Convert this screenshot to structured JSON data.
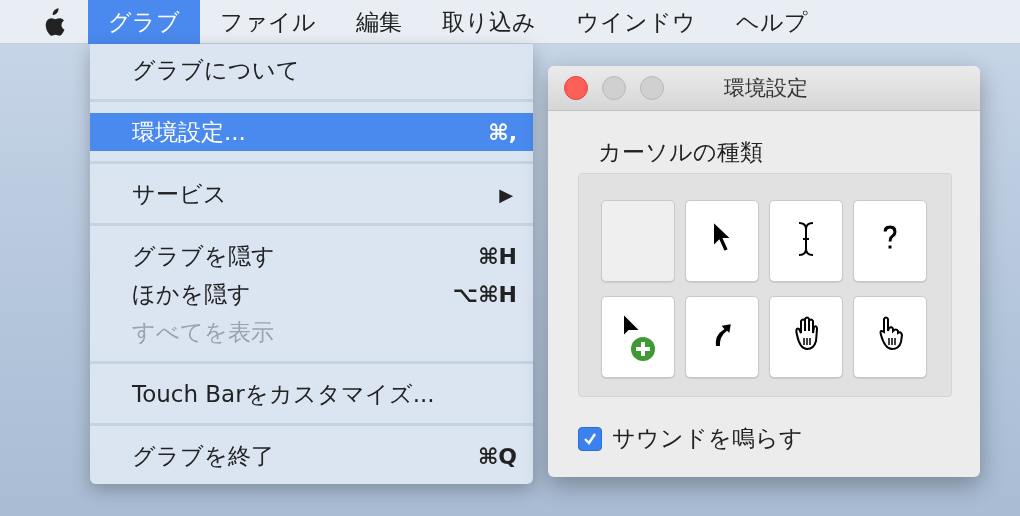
{
  "menu_bar": {
    "items": [
      {
        "label": "グラブ",
        "selected": true
      },
      {
        "label": "ファイル",
        "selected": false
      },
      {
        "label": "編集",
        "selected": false
      },
      {
        "label": "取り込み",
        "selected": false
      },
      {
        "label": "ウインドウ",
        "selected": false
      },
      {
        "label": "ヘルプ",
        "selected": false
      }
    ]
  },
  "dropdown_menu": {
    "sections": [
      {
        "items": [
          {
            "label": "グラブについて",
            "selected": false,
            "disabled": false
          }
        ]
      },
      {
        "items": [
          {
            "label": "環境設定...",
            "shortcut": "⌘,",
            "selected": true,
            "disabled": false
          }
        ]
      },
      {
        "items": [
          {
            "label": "サービス",
            "submenu": "▶",
            "selected": false,
            "disabled": false
          }
        ]
      },
      {
        "items": [
          {
            "label": "グラブを隠す",
            "shortcut": "⌘H",
            "selected": false,
            "disabled": false
          },
          {
            "label": "ほかを隠す",
            "shortcut": "⌥⌘H",
            "selected": false,
            "disabled": false
          },
          {
            "label": "すべてを表示",
            "selected": false,
            "disabled": true
          }
        ]
      },
      {
        "items": [
          {
            "label": "Touch Barをカスタマイズ...",
            "selected": false,
            "disabled": false
          }
        ]
      },
      {
        "items": [
          {
            "label": "グラブを終了",
            "shortcut": "⌘Q",
            "selected": false,
            "disabled": false
          }
        ]
      }
    ]
  },
  "preferences_window": {
    "title": "環境設定",
    "section_title": "カーソルの種類",
    "cursors": [
      {
        "kind": "none",
        "selected": true
      },
      {
        "kind": "arrow",
        "selected": false
      },
      {
        "kind": "ibeam",
        "selected": false
      },
      {
        "kind": "help",
        "selected": false
      },
      {
        "kind": "copy",
        "selected": false
      },
      {
        "kind": "alias",
        "selected": false
      },
      {
        "kind": "openhand",
        "selected": false
      },
      {
        "kind": "pointinghand",
        "selected": false
      }
    ],
    "checkbox": {
      "label": "サウンドを鳴らす",
      "checked": true
    }
  }
}
